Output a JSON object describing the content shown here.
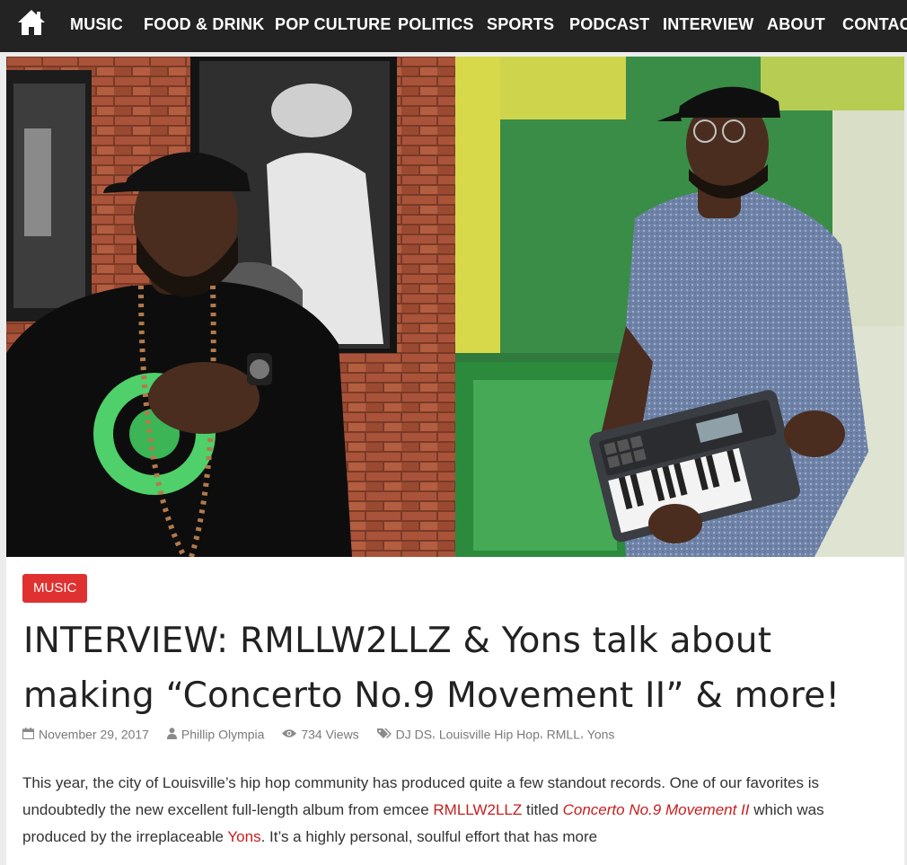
{
  "nav": {
    "home_icon": "home-icon",
    "items": [
      "MUSIC",
      "FOOD & DRINK",
      "POP CULTURE",
      "POLITICS",
      "SPORTS",
      "PODCAST",
      "INTERVIEW",
      "ABOUT",
      "CONTACT"
    ]
  },
  "article": {
    "category": "MUSIC",
    "title_line1": "INTERVIEW: RMLLW2LLZ & Yons talk about",
    "title_line2": "making “Concerto No.9 Movement II” & more!",
    "meta": {
      "date": "November 29, 2017",
      "author": "Phillip Olympia",
      "views": "734 Views",
      "tags": [
        "DJ DS",
        "Louisville Hip Hop",
        "RMLL",
        "Yons"
      ]
    },
    "body": {
      "t1": "This year, the city of Louisville’s hip hop community has produced quite a few standout records. One of our favorites is undoubtedly the new excellent full-length album from emcee ",
      "link_artist": "RMLLW2LLZ",
      "t2": " titled ",
      "link_album": "Concerto No.9 Movement II",
      "t3": " which was produced by the irreplaceable ",
      "link_producer": "Yons",
      "t4": ". It’s a highly personal, soulful effort that has more"
    }
  },
  "colors": {
    "nav_bg": "#232323",
    "accent": "#e03131",
    "link": "#c81e1e",
    "page_bg": "#ececec"
  }
}
